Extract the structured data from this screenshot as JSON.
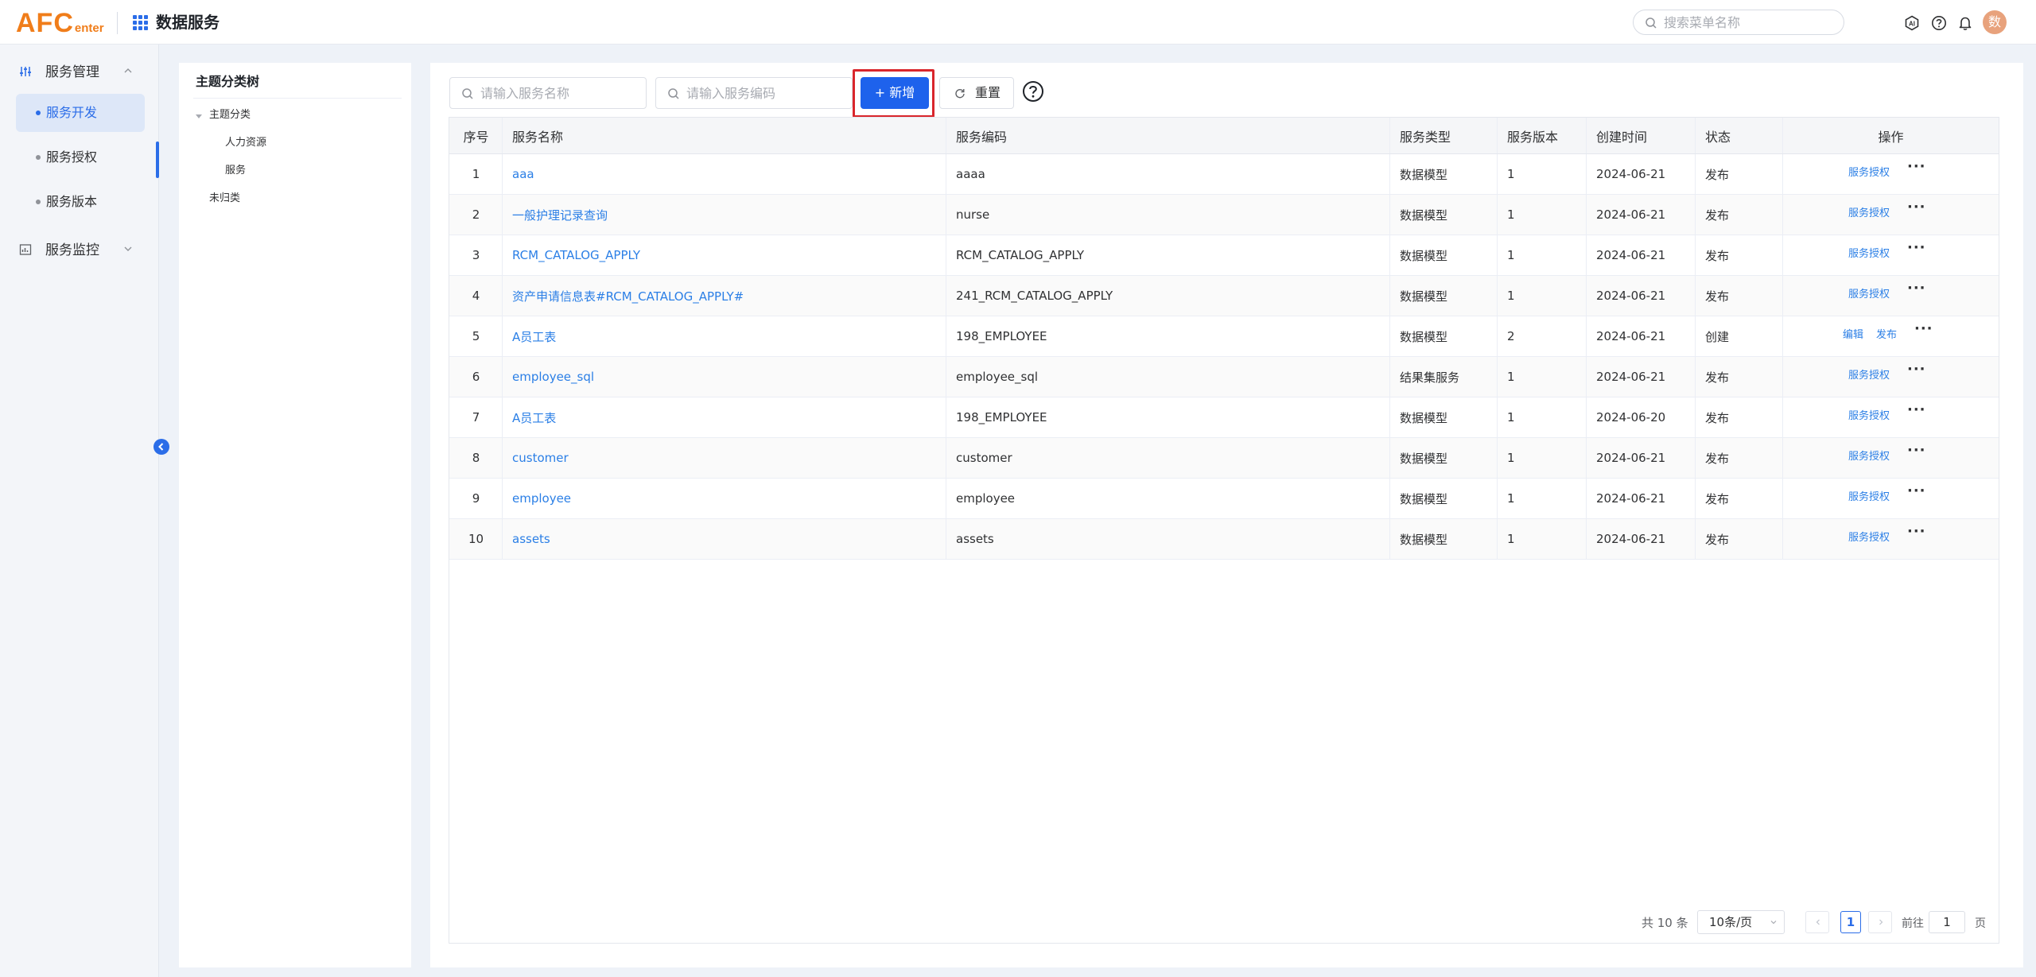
{
  "header": {
    "logo_main": "AFC",
    "logo_sub": "enter",
    "app_title": "数据服务",
    "menu_search_placeholder": "搜索菜单名称",
    "icons": [
      "ai-icon",
      "help-circle-icon",
      "bell-icon"
    ],
    "avatar_text": "数"
  },
  "sidebar": {
    "groups": [
      {
        "label": "服务管理",
        "icon": "sliders-icon",
        "expanded": true
      },
      {
        "label": "服务监控",
        "icon": "chart-icon",
        "expanded": false
      }
    ],
    "items": [
      {
        "label": "服务开发",
        "active": true
      },
      {
        "label": "服务授权",
        "active": false
      },
      {
        "label": "服务版本",
        "active": false
      }
    ]
  },
  "tree": {
    "title": "主题分类树",
    "nodes": [
      {
        "label": "主题分类"
      },
      {
        "label": "人力资源"
      },
      {
        "label": "服务"
      },
      {
        "label": "未归类"
      }
    ]
  },
  "toolbar": {
    "name_placeholder": "请输入服务名称",
    "code_placeholder": "请输入服务编码",
    "add_label": "+ 新增",
    "reset_label": "重置"
  },
  "table": {
    "columns": [
      "序号",
      "服务名称",
      "服务编码",
      "服务类型",
      "服务版本",
      "创建时间",
      "状态",
      "操作"
    ],
    "rows": [
      {
        "idx": "1",
        "name": "aaa",
        "code": "aaaa",
        "type": "数据模型",
        "version": "1",
        "created": "2024-06-21",
        "status": "发布",
        "ops": [
          "服务授权"
        ]
      },
      {
        "idx": "2",
        "name": "一般护理记录查询",
        "code": "nurse",
        "type": "数据模型",
        "version": "1",
        "created": "2024-06-21",
        "status": "发布",
        "ops": [
          "服务授权"
        ]
      },
      {
        "idx": "3",
        "name": "RCM_CATALOG_APPLY",
        "code": "RCM_CATALOG_APPLY",
        "type": "数据模型",
        "version": "1",
        "created": "2024-06-21",
        "status": "发布",
        "ops": [
          "服务授权"
        ]
      },
      {
        "idx": "4",
        "name": "资产申请信息表#RCM_CATALOG_APPLY#",
        "code": "241_RCM_CATALOG_APPLY",
        "type": "数据模型",
        "version": "1",
        "created": "2024-06-21",
        "status": "发布",
        "ops": [
          "服务授权"
        ]
      },
      {
        "idx": "5",
        "name": "A员工表",
        "code": "198_EMPLOYEE",
        "type": "数据模型",
        "version": "2",
        "created": "2024-06-21",
        "status": "创建",
        "ops": [
          "编辑",
          "发布"
        ]
      },
      {
        "idx": "6",
        "name": "employee_sql",
        "code": "employee_sql",
        "type": "结果集服务",
        "version": "1",
        "created": "2024-06-21",
        "status": "发布",
        "ops": [
          "服务授权"
        ]
      },
      {
        "idx": "7",
        "name": "A员工表",
        "code": "198_EMPLOYEE",
        "type": "数据模型",
        "version": "1",
        "created": "2024-06-20",
        "status": "发布",
        "ops": [
          "服务授权"
        ]
      },
      {
        "idx": "8",
        "name": "customer",
        "code": "customer",
        "type": "数据模型",
        "version": "1",
        "created": "2024-06-21",
        "status": "发布",
        "ops": [
          "服务授权"
        ]
      },
      {
        "idx": "9",
        "name": "employee",
        "code": "employee",
        "type": "数据模型",
        "version": "1",
        "created": "2024-06-21",
        "status": "发布",
        "ops": [
          "服务授权"
        ]
      },
      {
        "idx": "10",
        "name": "assets",
        "code": "assets",
        "type": "数据模型",
        "version": "1",
        "created": "2024-06-21",
        "status": "发布",
        "ops": [
          "服务授权"
        ]
      }
    ],
    "more_label": "···"
  },
  "pagination": {
    "total_text": "共 10 条",
    "page_size": "10条/页",
    "current_page": "1",
    "goto_label": "前往",
    "goto_value": "1",
    "page_suffix": "页"
  },
  "colors": {
    "primary": "#2b6de8",
    "link": "#2b7fe6",
    "logo": "#f07d1a",
    "highlight": "#d9262c"
  }
}
